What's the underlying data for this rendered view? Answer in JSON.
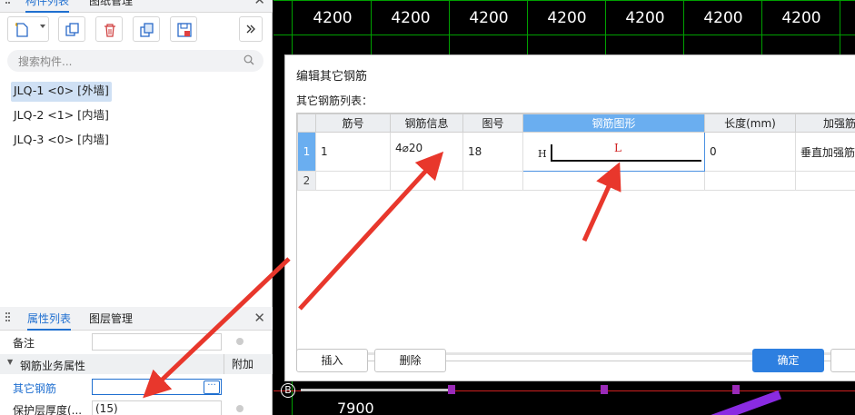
{
  "left_panel": {
    "top_tabs": [
      "构件列表",
      "图纸管理"
    ],
    "search_placeholder": "搜索构件...",
    "components": [
      "JLQ-1 <0> [外墙]",
      "JLQ-2 <1> [内墙]",
      "JLQ-3 <0> [内墙]"
    ],
    "prop_tabs": [
      "属性列表",
      "图层管理"
    ],
    "props": {
      "remark_label": "备注",
      "remark_value": "",
      "group_label": "钢筋业务属性",
      "group_extra": "附加",
      "other_rebar_label": "其它钢筋",
      "cover_label": "保护层厚度(...",
      "cover_value": "(15)"
    }
  },
  "cad": {
    "dimensions": [
      "4200",
      "4200",
      "4200",
      "4200",
      "4200",
      "4200",
      "4200"
    ],
    "bottom_dimension": "7900",
    "axis_label": "B"
  },
  "dialog": {
    "title": "编辑其它钢筋",
    "list_label": "其它钢筋列表：",
    "columns": [
      "筋号",
      "钢筋信息",
      "图号",
      "钢筋图形",
      "长度(mm)",
      "加强筋"
    ],
    "rows": [
      {
        "num": "1",
        "bar_no": "1",
        "info": "4⌀20",
        "fig": "18",
        "shape_h": "H",
        "shape_l": "L",
        "length": "0",
        "strengthen": "垂直加强筋"
      },
      {
        "num": "2",
        "bar_no": "",
        "info": "",
        "fig": "",
        "shape_h": "",
        "shape_l": "",
        "length": "",
        "strengthen": ""
      }
    ],
    "buttons": {
      "insert": "插入",
      "delete": "删除",
      "ok": "确定"
    }
  }
}
